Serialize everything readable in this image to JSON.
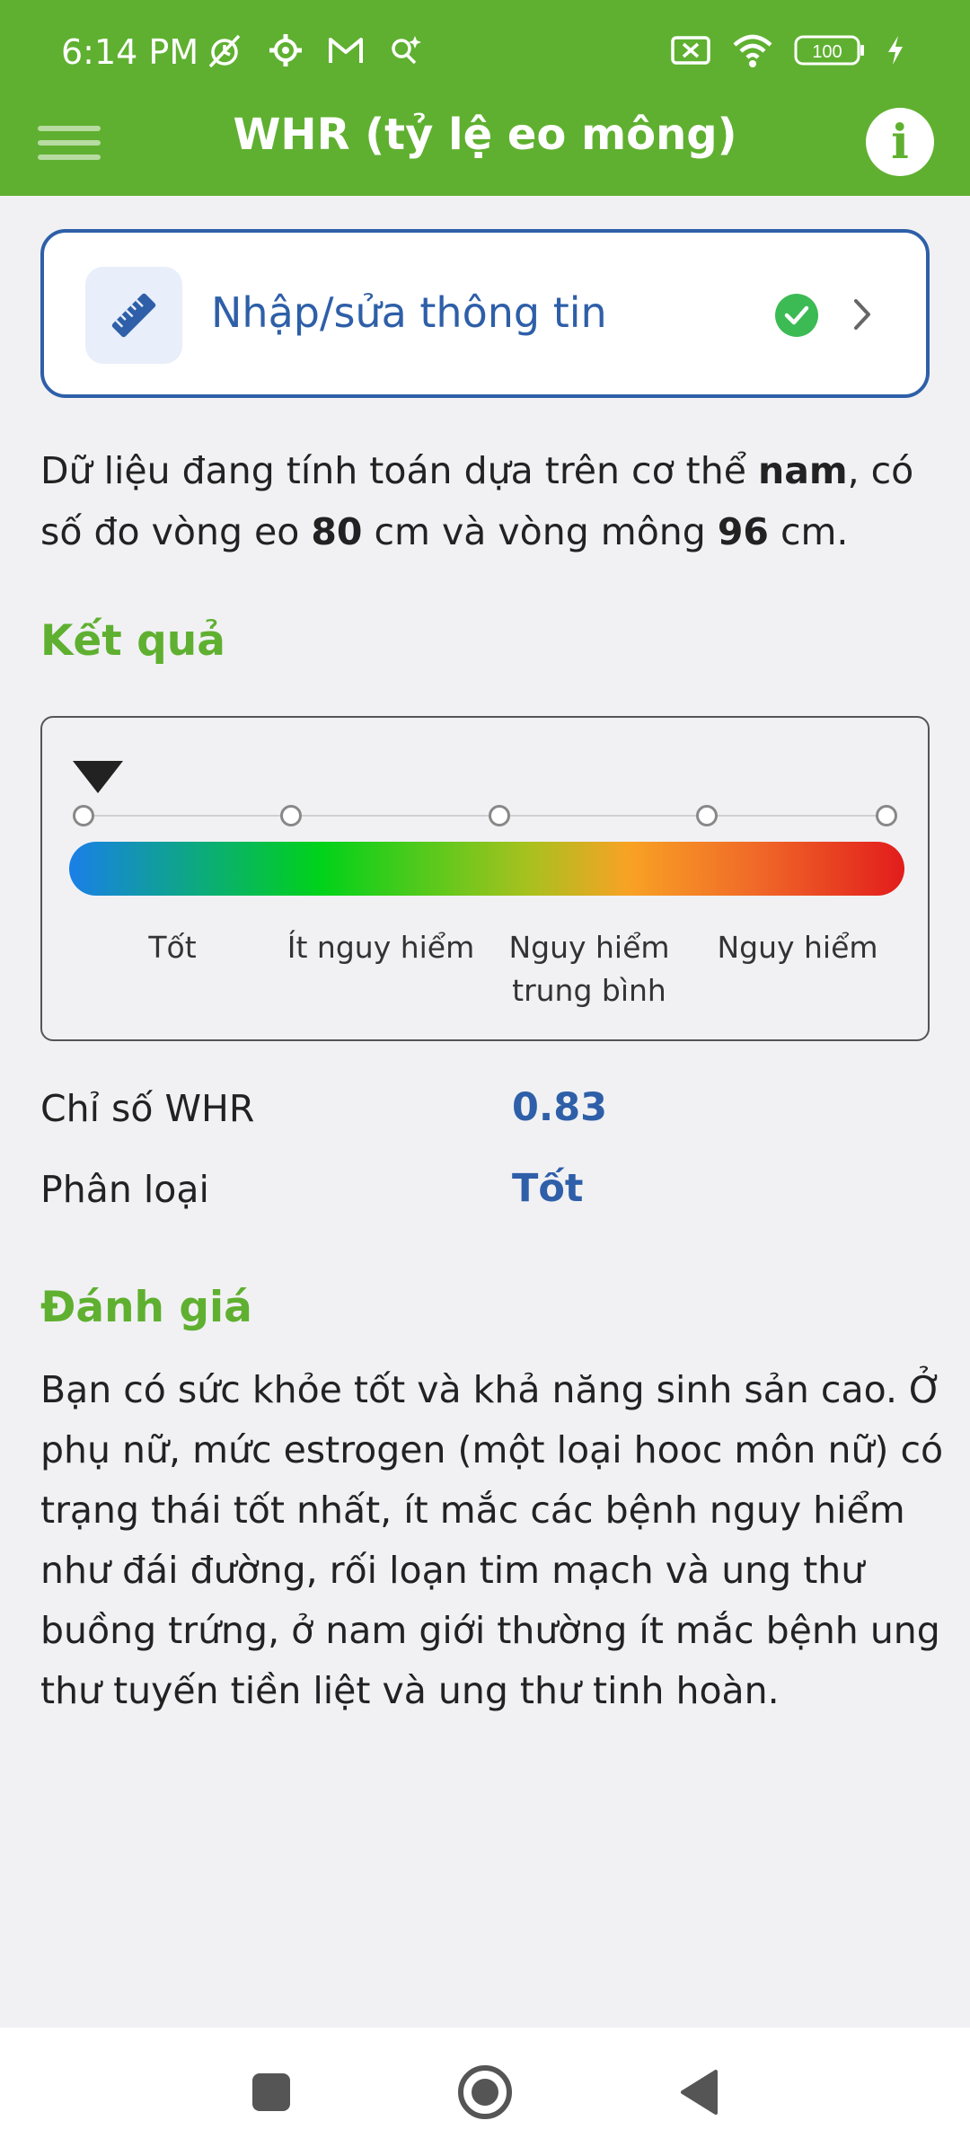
{
  "status_bar": {
    "time": "6:14 PM",
    "left_icons": [
      "mute-alarm-icon",
      "settings-gear-icon",
      "gmail-icon",
      "search-sparkle-icon"
    ],
    "right_icons": [
      "sim-off-icon",
      "wifi-icon",
      "battery-icon",
      "charging-icon"
    ],
    "battery": "100"
  },
  "appbar": {
    "title": "WHR (tỷ lệ eo mông)",
    "info_label": "i"
  },
  "input_card": {
    "label": "Nhập/sửa thông tin",
    "status": "completed"
  },
  "description": {
    "part1": "Dữ liệu đang tính toán dựa trên cơ thể ",
    "gender": "nam",
    "part2": ", có số đo vòng eo ",
    "waist": "80",
    "part3": " cm và vòng mông ",
    "hip": "96",
    "part4": " cm."
  },
  "result": {
    "title": "Kết quả",
    "scale_labels": [
      "Tốt",
      "Ít nguy hiểm",
      "Nguy hiểm\ntrung bình",
      "Nguy hiểm"
    ],
    "pointer_position": 0
  },
  "stats": {
    "whr_label": "Chỉ số WHR",
    "whr_value": "0.83",
    "class_label": "Phân loại",
    "class_value": "Tốt"
  },
  "assessment": {
    "title": "Đánh giá",
    "text": "Bạn có sức khỏe tốt và khả năng sinh sản cao. Ở phụ nữ, mức estrogen (một loại hooc môn nữ) có trạng thái tốt nhất, ít mắc các bệnh nguy hiểm như đái đường, rối loạn tim mạch và ung thư buồng trứng, ở nam giới thường ít mắc bệnh ung thư tuyến tiền liệt và ung thư tinh hoàn."
  },
  "colors": {
    "primary_green": "#5fb030",
    "accent_blue": "#2e5fa8",
    "success_green": "#3cba54"
  }
}
